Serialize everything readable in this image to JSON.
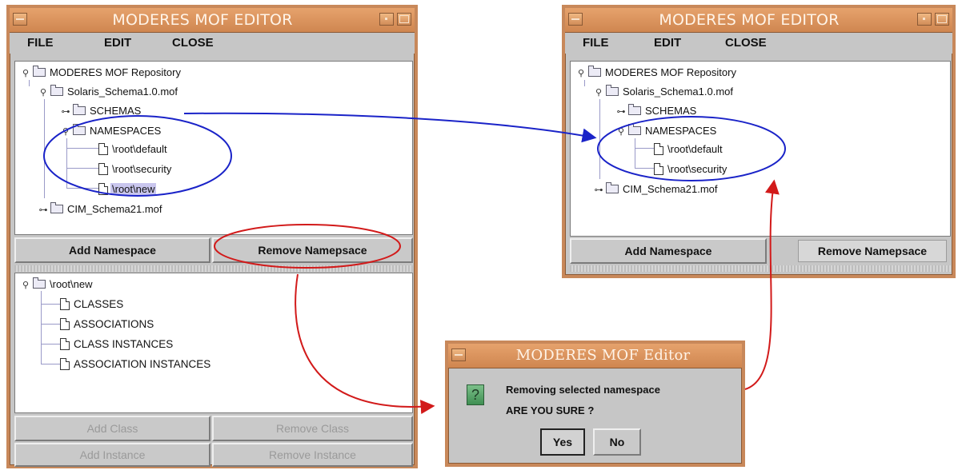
{
  "editor_main": {
    "title": "MODERES MOF EDITOR",
    "menu": [
      "FILE",
      "EDIT",
      "CLOSE"
    ],
    "tree": {
      "root": "MODERES MOF Repository",
      "schema_file": "Solaris_Schema1.0.mof",
      "schemas": "SCHEMAS",
      "namespaces": "NAMESPACES",
      "ns_items": [
        "\\root\\default",
        "\\root\\security",
        "\\root\\new"
      ],
      "cim_file": "CIM_Schema21.mof"
    },
    "buttons": {
      "add_namespace": "Add Namespace",
      "remove_namespace": "Remove Namepsace"
    },
    "detail": {
      "root": "\\root\\new",
      "items": [
        "CLASSES",
        "ASSOCIATIONS",
        "CLASS INSTANCES",
        "ASSOCIATION INSTANCES"
      ]
    },
    "bottom_buttons": {
      "add_class": "Add Class",
      "remove_class": "Remove Class",
      "add_instance": "Add Instance",
      "remove_instance": "Remove Instance"
    }
  },
  "editor_result": {
    "title": "MODERES MOF EDITOR",
    "menu": [
      "FILE",
      "EDIT",
      "CLOSE"
    ],
    "tree": {
      "root": "MODERES MOF Repository",
      "schema_file": "Solaris_Schema1.0.mof",
      "schemas": "SCHEMAS",
      "namespaces": "NAMESPACES",
      "ns_items": [
        "\\root\\default",
        "\\root\\security"
      ],
      "cim_file": "CIM_Schema21.mof"
    },
    "buttons": {
      "add_namespace": "Add Namespace",
      "remove_namespace": "Remove Namepsace"
    }
  },
  "dialog": {
    "title": "MODERES MOF Editor",
    "message_line1": "Removing selected namespace",
    "message_line2": "ARE YOU SURE ?",
    "yes": "Yes",
    "no": "No"
  },
  "annotation_colors": {
    "blue": "#1a23c8",
    "red": "#d21a1a",
    "window_border": "#c8885a"
  }
}
